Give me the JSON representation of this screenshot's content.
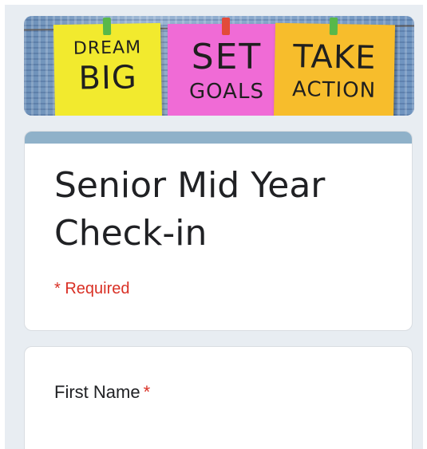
{
  "banner": {
    "notes": [
      {
        "line1": "DREAM",
        "line2": "BIG",
        "color": "#f2ea2e"
      },
      {
        "line1": "SET",
        "line2": "GOALS",
        "color": "#f06bd6"
      },
      {
        "line1": "TAKE",
        "line2": "ACTION",
        "color": "#f7bd2c"
      }
    ]
  },
  "form": {
    "title": "Senior Mid Year Check-in",
    "required_note": "* Required",
    "accent_color": "#8fb1c9"
  },
  "questions": [
    {
      "label": "First Name",
      "required_mark": "*",
      "value": ""
    }
  ]
}
